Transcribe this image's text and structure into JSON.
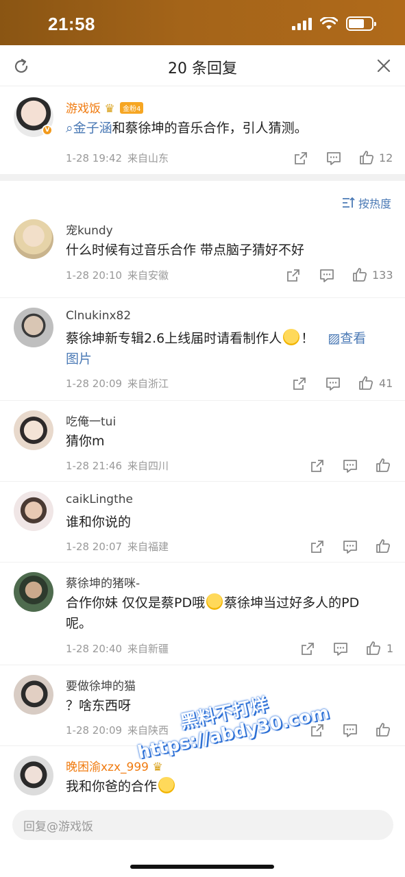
{
  "status_bar": {
    "time": "21:58"
  },
  "header": {
    "title": "20 条回复"
  },
  "main_comment": {
    "username": "游戏饭",
    "fan_badge": "金粉4",
    "mention": "金子涵",
    "text": "和蔡徐坤的音乐合作，引人猜测。",
    "time": "1-28 19:42",
    "location": "来自山东",
    "like_count": "12"
  },
  "sort": {
    "label": "按热度"
  },
  "replies": [
    {
      "username": "宠kundy",
      "text": "什么时候有过音乐合作 带点脑子猜好不好",
      "time": "1-28 20:10",
      "location": "来自安徽",
      "like_count": "133"
    },
    {
      "username": "Clnukinx82",
      "text_before": "蔡徐坤新专辑2.6上线届时请看制作人",
      "text_after": "！",
      "view_image": "查看图片",
      "view_image_1": "查看",
      "view_image_2": "图片",
      "time": "1-28 20:09",
      "location": "来自浙江",
      "like_count": "41"
    },
    {
      "username": "吃俺一tui",
      "text": "猜你m",
      "time": "1-28 21:46",
      "location": "来自四川",
      "like_count": ""
    },
    {
      "username": "caikLingthe",
      "text": "谁和你说的",
      "time": "1-28 20:07",
      "location": "来自福建",
      "like_count": ""
    },
    {
      "username": "蔡徐坤的猪咪-",
      "text_before": "合作你妹 仅仅是蔡PD哦",
      "text_after": "蔡徐坤当过好多人的PD",
      "text_line2": "呢。",
      "time": "1-28 20:40",
      "location": "来自新疆",
      "like_count": "1"
    },
    {
      "username": "要做徐坤的猫",
      "text": "？啥东西呀",
      "time": "1-28 20:09",
      "location": "来自陕西",
      "like_count": ""
    },
    {
      "username": "晚困渝xzx_999",
      "text": "我和你爸的合作",
      "time": "",
      "location": "",
      "like_count": ""
    }
  ],
  "input": {
    "placeholder": "回复@游戏饭"
  },
  "watermark": {
    "line1": "黑料不打烊",
    "line2": "https://abdy30.com"
  },
  "colors": {
    "accent_blue": "#4a79b5",
    "username_orange": "#f07b10",
    "status_bar": "#a46419"
  }
}
